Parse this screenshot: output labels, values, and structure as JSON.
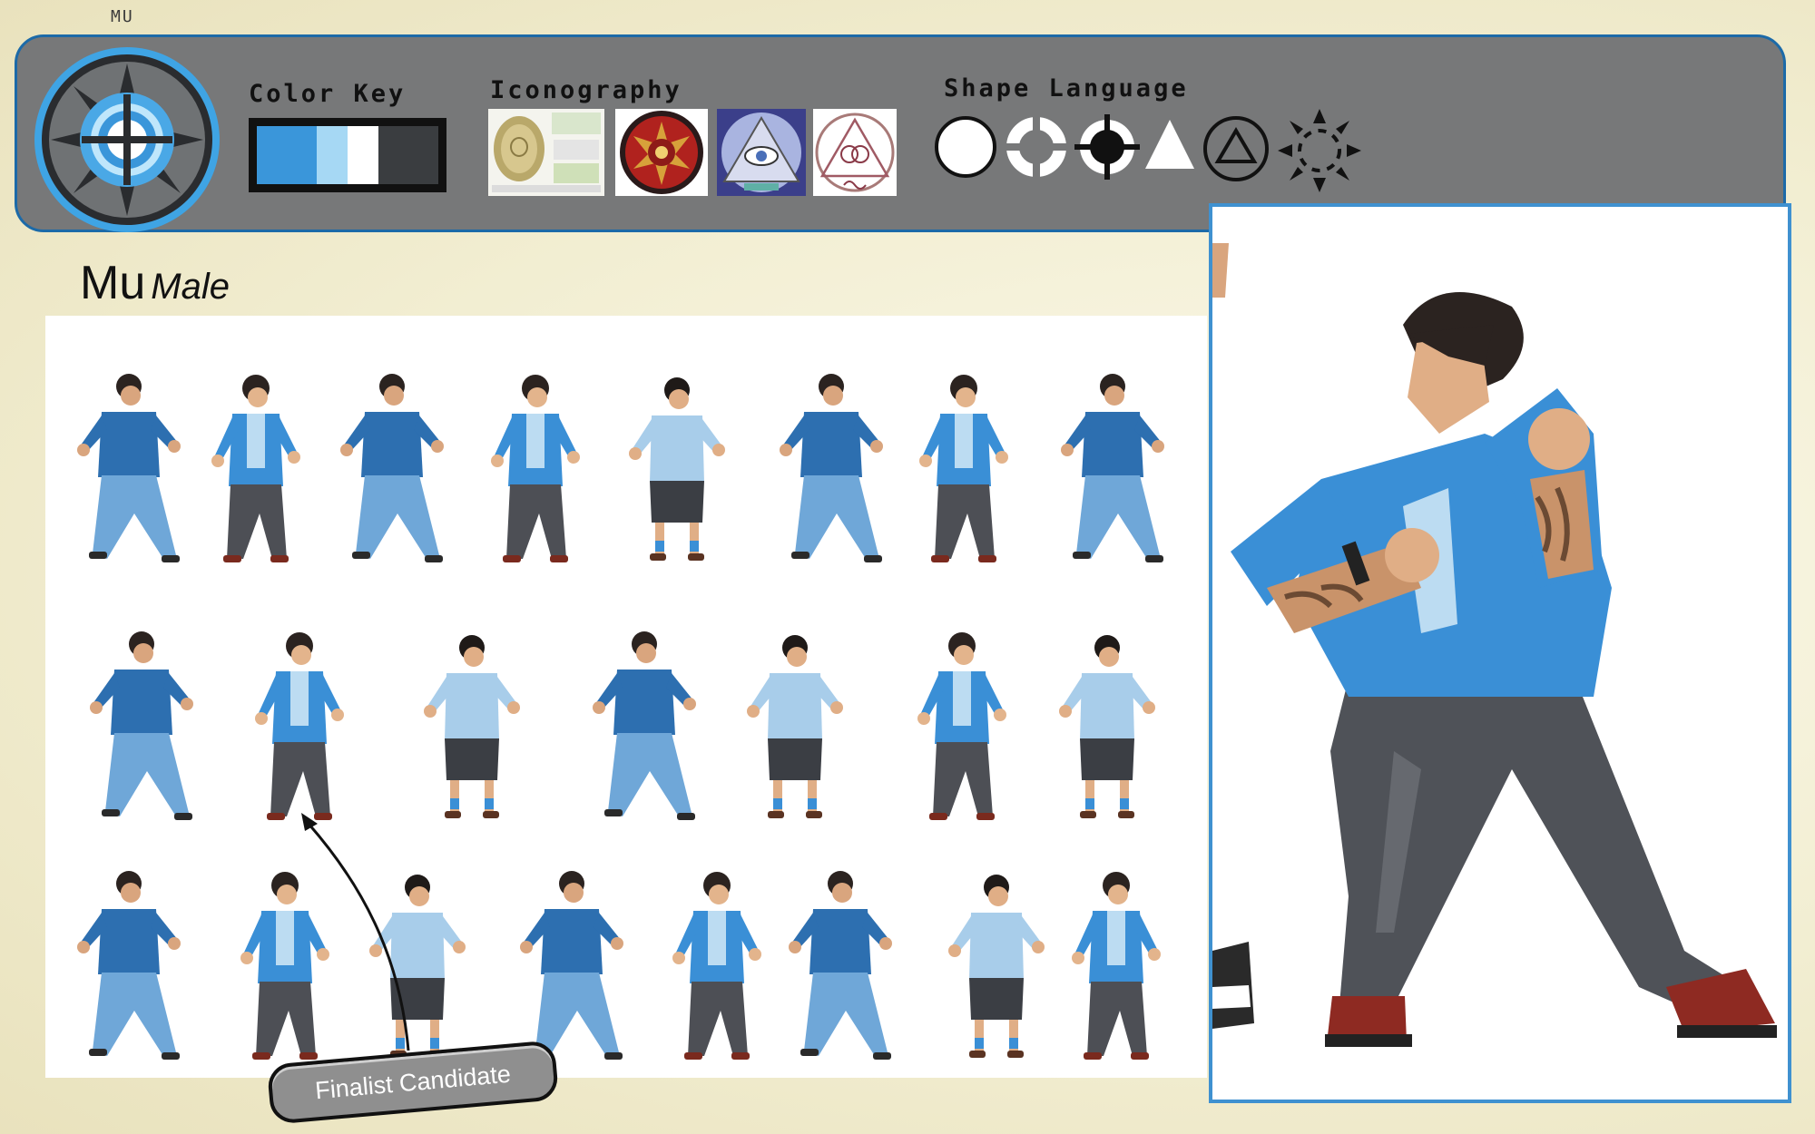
{
  "watermark": "MU",
  "banner": {
    "color_key_title": "Color Key",
    "iconography_title": "Iconography",
    "shape_language_title": "Shape Language",
    "palette": [
      "#3a96da",
      "#a6d8f4",
      "#ffffff",
      "#3a3d40"
    ]
  },
  "heading": {
    "title": "Mu",
    "subtitle": "Male"
  },
  "callout": {
    "label": "Finalist Candidate"
  }
}
